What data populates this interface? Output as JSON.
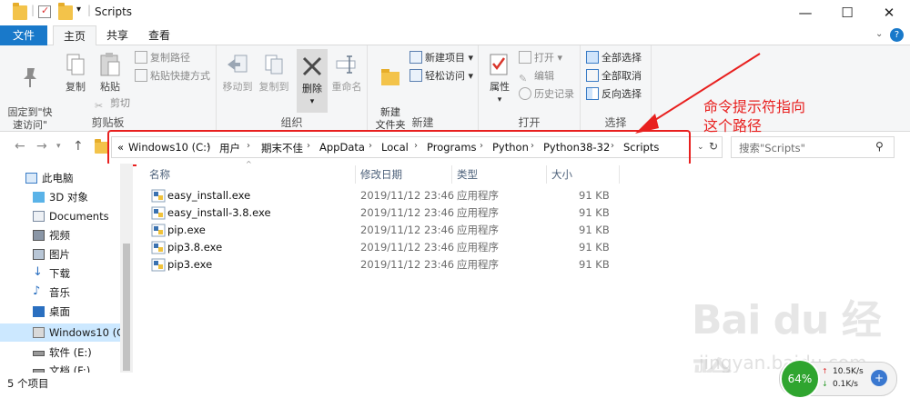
{
  "window": {
    "title": "Scripts",
    "minimize": "—",
    "maximize": "☐",
    "close": "✕",
    "help_icon": "?"
  },
  "tabs": [
    {
      "label": "文件"
    },
    {
      "label": "主页"
    },
    {
      "label": "共享"
    },
    {
      "label": "查看"
    }
  ],
  "ribbon": {
    "clipboard": {
      "label": "剪贴板",
      "pin": "固定到\"快\n速访问\"",
      "copy": "复制",
      "paste": "粘贴",
      "copy_path": "复制路径",
      "paste_shortcut": "粘贴快捷方式",
      "cut": "剪切"
    },
    "organize": {
      "label": "组织",
      "move_to": "移动到",
      "copy_to": "复制到",
      "delete": "删除",
      "rename": "重命名"
    },
    "new": {
      "label": "新建",
      "new_folder": "新建\n文件夹",
      "new_item": "新建项目",
      "easy_access": "轻松访问"
    },
    "open": {
      "label": "打开",
      "properties": "属性",
      "open": "打开",
      "edit": "编辑",
      "history": "历史记录"
    },
    "select": {
      "label": "选择",
      "select_all": "全部选择",
      "select_none": "全部取消",
      "invert": "反向选择"
    }
  },
  "address": {
    "prefix": "«",
    "crumbs": [
      "Windows10 (C:)",
      "用户",
      "期末不佳",
      "AppData",
      "Local",
      "Programs",
      "Python",
      "Python38-32",
      "Scripts"
    ],
    "search_placeholder": "搜索\"Scripts\""
  },
  "annotation": {
    "line1": "命令提示符指向",
    "line2": "这个路径"
  },
  "nav": [
    {
      "label": "此电脑"
    },
    {
      "label": "3D 对象"
    },
    {
      "label": "Documents"
    },
    {
      "label": "视频"
    },
    {
      "label": "图片"
    },
    {
      "label": "下载"
    },
    {
      "label": "音乐"
    },
    {
      "label": "桌面"
    },
    {
      "label": "Windows10 (C:)"
    },
    {
      "label": "软件 (E:)"
    },
    {
      "label": "文档 (F:)"
    }
  ],
  "columns": {
    "name": "名称",
    "date": "修改日期",
    "type": "类型",
    "size": "大小"
  },
  "files": [
    {
      "name": "easy_install.exe",
      "date": "2019/11/12 23:46",
      "type": "应用程序",
      "size": "91 KB"
    },
    {
      "name": "easy_install-3.8.exe",
      "date": "2019/11/12 23:46",
      "type": "应用程序",
      "size": "91 KB"
    },
    {
      "name": "pip.exe",
      "date": "2019/11/12 23:46",
      "type": "应用程序",
      "size": "91 KB"
    },
    {
      "name": "pip3.8.exe",
      "date": "2019/11/12 23:46",
      "type": "应用程序",
      "size": "91 KB"
    },
    {
      "name": "pip3.exe",
      "date": "2019/11/12 23:46",
      "type": "应用程序",
      "size": "91 KB"
    }
  ],
  "status": {
    "count": "5 个项目"
  },
  "speed_widget": {
    "percent": "64%",
    "up": "10.5K/s",
    "down": "0.1K/s"
  },
  "watermark": {
    "main": "Bai du 经验",
    "sub": "jingyan.baidu.com"
  }
}
